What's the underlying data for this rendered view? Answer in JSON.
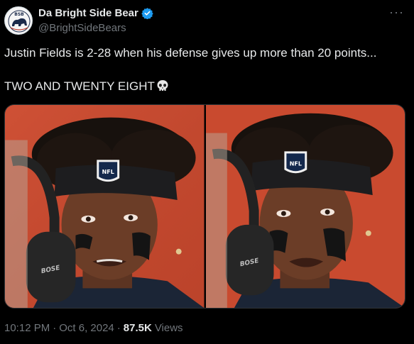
{
  "author": {
    "display_name": "Da Bright Side Bear",
    "handle": "@BrightSideBears",
    "verified": true,
    "avatar_logo_text": "BSB",
    "avatar_icon": "bear-logo-icon"
  },
  "tweet": {
    "line1": "Justin Fields is 2-28 when his defense gives up more than 20 points...",
    "line2": "TWO AND TWENTY EIGHT",
    "emoji": "skull-icon"
  },
  "media": {
    "panels": [
      {
        "logo_text": "NFL",
        "headphone_text": "BOSE"
      },
      {
        "logo_text": "NFL",
        "headphone_text": "BOSE"
      }
    ]
  },
  "footer": {
    "time": "10:12 PM",
    "date": "Oct 6, 2024",
    "views_count": "87.5K",
    "views_label": "Views",
    "separator": "·"
  },
  "colors": {
    "accent_blue": "#1d9bf0",
    "background": "#000000",
    "text_primary": "#e7e9ea",
    "text_secondary": "#71767b",
    "photo_background": "#c94a2f"
  }
}
